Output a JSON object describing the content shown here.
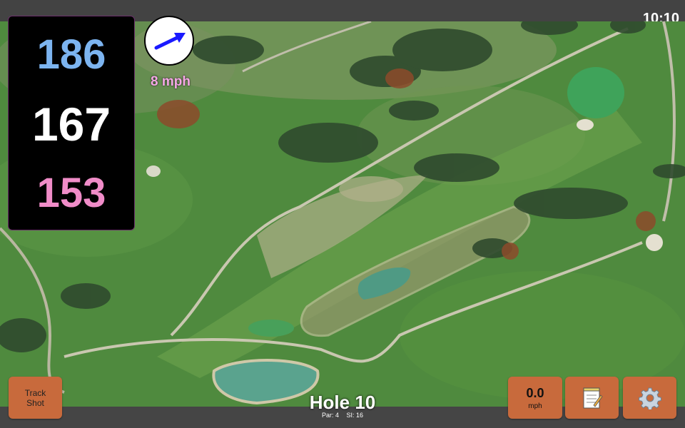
{
  "status": {
    "time": "10:10"
  },
  "yardages": {
    "back": "186",
    "center": "167",
    "front": "153"
  },
  "wind": {
    "speed_label": "8 mph",
    "direction_icon": "wind-arrow-icon"
  },
  "hole": {
    "title": "Hole 10",
    "par_label": "Par: 4",
    "si_label": "SI: 16"
  },
  "buttons": {
    "track_shot_line1": "Track",
    "track_shot_line2": "Shot",
    "speed_value": "0.0",
    "speed_unit": "mph",
    "notes_icon": "notepad-icon",
    "settings_icon": "gear-icon"
  },
  "colors": {
    "back_yardage": "#7cb4f0",
    "center_yardage": "#ffffff",
    "front_yardage": "#f08cc8",
    "wind_text": "#f5a8e6",
    "button_bg": "#c86a3c"
  }
}
